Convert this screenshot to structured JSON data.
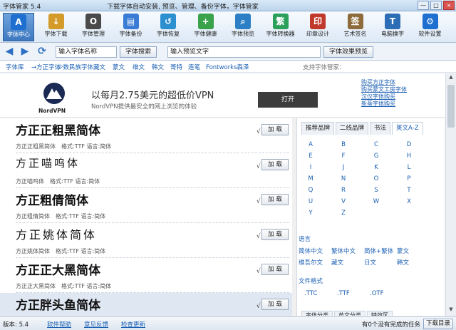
{
  "window": {
    "title": "字体管家 5.4",
    "menu": "下载字体自动安装, 预览、管理、备份字体，字体管家",
    "min": "—",
    "max": "□",
    "close": "×"
  },
  "toolbar": [
    {
      "label": "字体中心",
      "icon": "font-center-icon",
      "glyph": "A",
      "color": "#1f6fd0",
      "active": true
    },
    {
      "label": "字体下载",
      "icon": "download-icon",
      "glyph": "↓",
      "color": "#d49a2a"
    },
    {
      "label": "字体管理",
      "icon": "manage-icon",
      "glyph": "O",
      "color": "#4a4a4a"
    },
    {
      "label": "字体备份",
      "icon": "backup-icon",
      "glyph": "▤",
      "color": "#3a7bd5"
    },
    {
      "label": "字体恢复",
      "icon": "restore-icon",
      "glyph": "↺",
      "color": "#2b8fd0"
    },
    {
      "label": "字体健康",
      "icon": "health-icon",
      "glyph": "+",
      "color": "#3aa24a"
    },
    {
      "label": "字体预览",
      "icon": "preview-icon",
      "glyph": "⌕",
      "color": "#2c7fc4"
    },
    {
      "label": "字体转换器",
      "icon": "converter-icon",
      "glyph": "繁",
      "color": "#2aa05a"
    },
    {
      "label": "印章设计",
      "icon": "seal-icon",
      "glyph": "印",
      "color": "#c0392b"
    },
    {
      "label": "艺术签名",
      "icon": "signature-icon",
      "glyph": "签",
      "color": "#8e6b3a"
    },
    {
      "label": "电脑换字",
      "icon": "replace-icon",
      "glyph": "T",
      "color": "#2c6db5"
    },
    {
      "label": "软件设置",
      "icon": "settings-icon",
      "glyph": "⚙",
      "color": "#1f6fd0"
    }
  ],
  "search": {
    "back": "◀",
    "forward": "▶",
    "refresh": "⟳",
    "font_placeholder": "输入字体名称",
    "search_btn": "字体搜索",
    "preview_placeholder": "输入预览文字",
    "preview_btn": "字体效果预览"
  },
  "filters": {
    "items": [
      "字体库",
      "→方正字体",
      "少数民族字体",
      "藏文",
      "蒙文",
      "维文",
      "韩文",
      "哥特",
      "连笔",
      "Fontworks森泽"
    ],
    "support": "支持字体管家："
  },
  "ad": {
    "brand": "NordVPN",
    "headline": "以每月2.75美元的超低价VPN",
    "sub": "NordVPN提供最安全的网上浏览的体验",
    "open": "打开"
  },
  "ad_links": [
    "购买方正字体",
    "购买蒙文工房字体",
    "汉仪字体购买",
    "新蒂字体购买"
  ],
  "fonts": [
    {
      "preview": "方正正粗黑简体",
      "info": "方正正粗黑简体　格式:TTF 语言:简体",
      "size": 17,
      "weight": "bold",
      "sel": false
    },
    {
      "preview": "方正喵呜体",
      "info": "方正喵呜体　格式:TTF 语言:简体",
      "size": 15,
      "weight": "normal",
      "sel": false
    },
    {
      "preview": "方正粗倩简体",
      "info": "方正粗倩简体　格式:TTF 语言:简体",
      "size": 17,
      "weight": "bold",
      "sel": false
    },
    {
      "preview": "方正姚体简体",
      "info": "方正姚体简体　格式:TTF 语言:简体",
      "size": 16,
      "weight": "normal",
      "sel": false
    },
    {
      "preview": "方正正大黑简体",
      "info": "方正正大黑简体　格式:TTF 语言:简体",
      "size": 17,
      "weight": "bold",
      "sel": false
    },
    {
      "preview": "方正胖头鱼简体",
      "info": "",
      "size": 17,
      "weight": "bold",
      "sel": true
    }
  ],
  "font_action": "加 载",
  "check": "√",
  "side_tabs": [
    "推荐品牌",
    "二线品牌",
    "书法",
    "英文A-Z"
  ],
  "letters": [
    "A",
    "B",
    "C",
    "D",
    "E",
    "F",
    "G",
    "H",
    "I",
    "J",
    "K",
    "L",
    "M",
    "N",
    "O",
    "P",
    "Q",
    "R",
    "S",
    "T",
    "U",
    "V",
    "W",
    "X",
    "Y",
    "Z"
  ],
  "lang_title": "语言",
  "langs": [
    "简体中文",
    "繁体中文",
    "简体+繁体",
    "蒙文",
    "维吾尔文",
    "藏文",
    "日文",
    "韩文"
  ],
  "format_title": "文件格式",
  "formats": [
    ".TTC",
    ".TTF",
    ".OTF"
  ],
  "bottom_tabs": [
    "字体分类",
    "英文分类",
    "特效区"
  ],
  "status": {
    "version": "版本: 5.4",
    "help": "软件帮助",
    "feedback": "意见反馈",
    "update": "检查更新",
    "tasks": "有0个没有完成的任务",
    "dl_dir": "下载目录"
  }
}
